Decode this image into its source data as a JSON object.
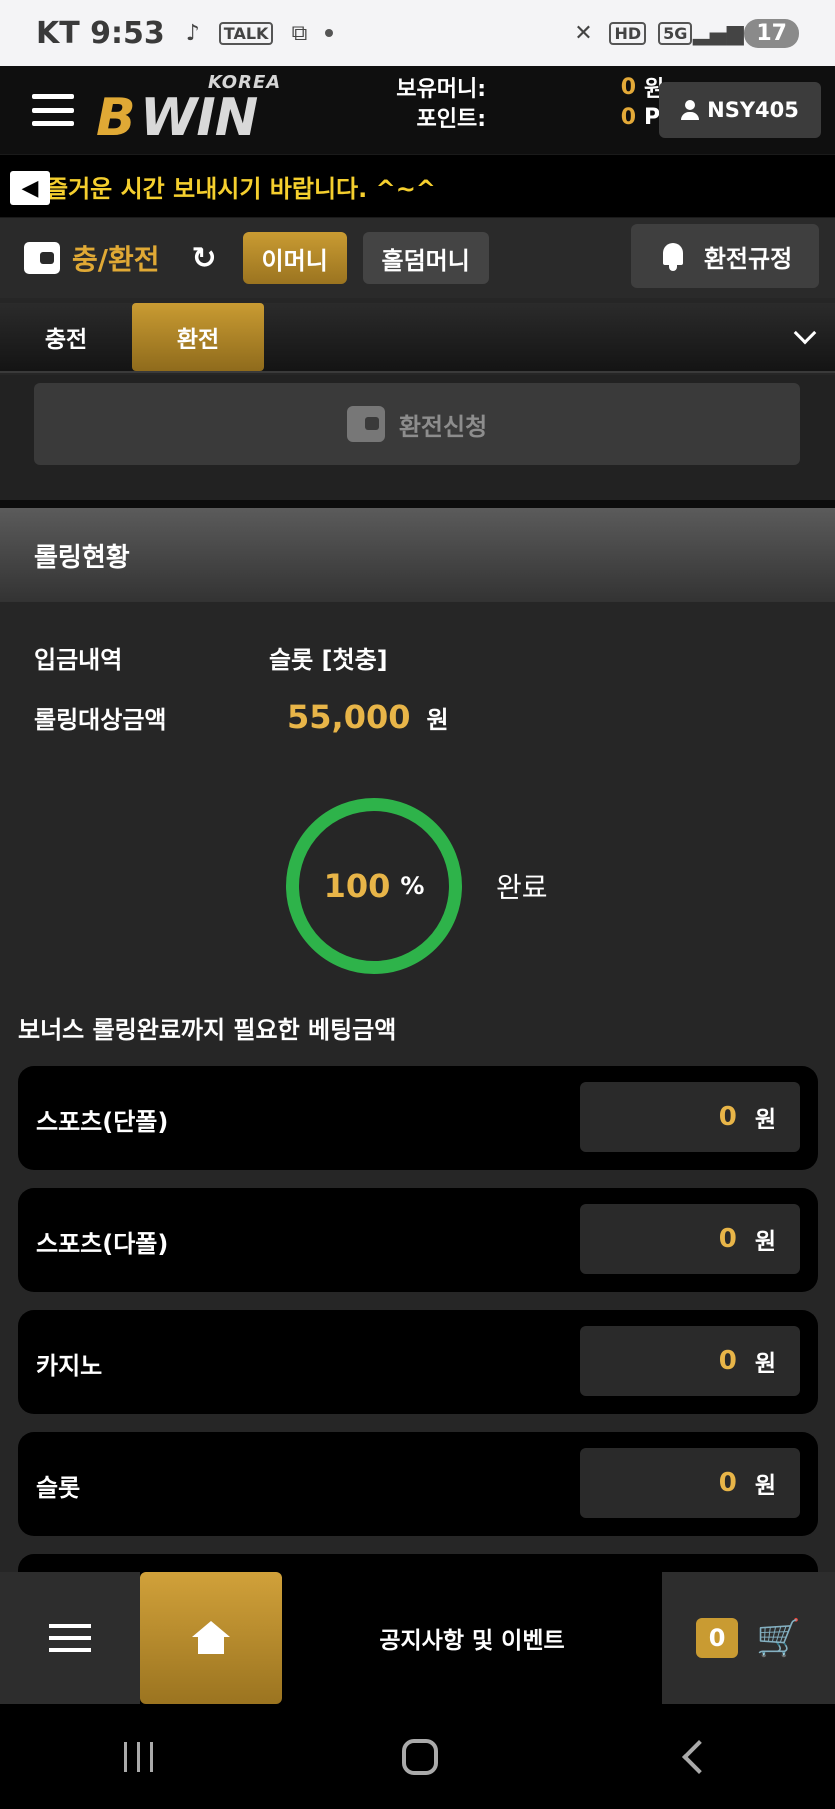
{
  "status_bar": {
    "carrier": "KT 9:53",
    "talk_label": "TALK",
    "hd_label": "HD",
    "network_label": "5G",
    "battery": "17"
  },
  "header": {
    "logo_top": "KOREA",
    "logo_b": "B",
    "logo_main": "WIN",
    "money_label": "보유머니:",
    "money_value": "0",
    "money_unit": "원",
    "points_label": "포인트:",
    "points_value": "0",
    "points_unit": "P",
    "username": "NSY405"
  },
  "marquee": {
    "text": "즐거운 시간 보내시기 바랍니다. ^~^"
  },
  "titlebar": {
    "title": "충/환전",
    "refresh_glyph": "↻",
    "emoney_btn": "이머니",
    "holdem_btn": "홀덤머니",
    "rules_btn": "환전규정"
  },
  "tabs": [
    {
      "label": "충전"
    },
    {
      "label": "환전"
    }
  ],
  "withdraw": {
    "request_btn": "환전신청"
  },
  "rolling": {
    "title": "롤링현황",
    "deposit_label": "입금내역",
    "deposit_value": "슬롯 [첫충]",
    "target_label": "롤링대상금액",
    "target_amount": "55,000",
    "target_unit": "원",
    "progress_value": "100",
    "progress_symbol": "%",
    "progress_status": "완료",
    "bonus_title": "보너스 롤링완료까지 필요한 베팅금액",
    "items": [
      {
        "label": "스포츠(단폴)",
        "value": "0",
        "unit": "원"
      },
      {
        "label": "스포츠(다폴)",
        "value": "0",
        "unit": "원"
      },
      {
        "label": "카지노",
        "value": "0",
        "unit": "원"
      },
      {
        "label": "슬롯",
        "value": "0",
        "unit": "원"
      }
    ]
  },
  "bottombar": {
    "notice_label": "공지사항 및 이벤트",
    "cart_count": "0"
  },
  "colors": {
    "gold": "#c99b32",
    "amount": "#e8b548",
    "ring": "#2eb34a",
    "marquee_text": "#f5cf2e"
  }
}
